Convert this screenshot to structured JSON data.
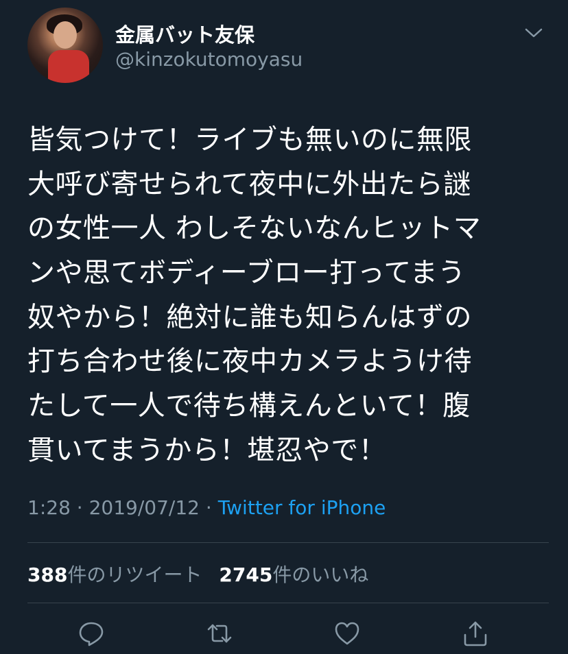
{
  "author": {
    "display_name": "金属バット友保",
    "handle": "@kinzokutomoyasu"
  },
  "tweet": {
    "lines": [
      "皆気つけて！ライブも無いのに無限",
      "大呼び寄せられて夜中に外出たら謎",
      "の女性一人 わしそないなんヒットマ",
      "ンや思てボディーブロー打ってまう",
      "奴やから！絶対に誰も知らんはずの",
      "打ち合わせ後に夜中カメラようけ待",
      "たして一人で待ち構えんといて！腹",
      "貫いてまうから！堪忍やで！"
    ]
  },
  "meta": {
    "time": "1:28",
    "separator1": " · ",
    "date": "2019/07/12",
    "separator2": " · ",
    "source": "Twitter for iPhone"
  },
  "stats": {
    "retweets_count": "388",
    "retweets_label": "件のリツイート",
    "likes_count": "2745",
    "likes_label": "件のいいね"
  },
  "icons": {
    "menu": "chevron-down-icon",
    "reply": "reply-icon",
    "retweet": "retweet-icon",
    "like": "heart-icon",
    "share": "share-icon"
  },
  "colors": {
    "background": "#15202b",
    "secondary_text": "#8899a6",
    "link": "#1da1f2",
    "divider": "#38444d"
  }
}
